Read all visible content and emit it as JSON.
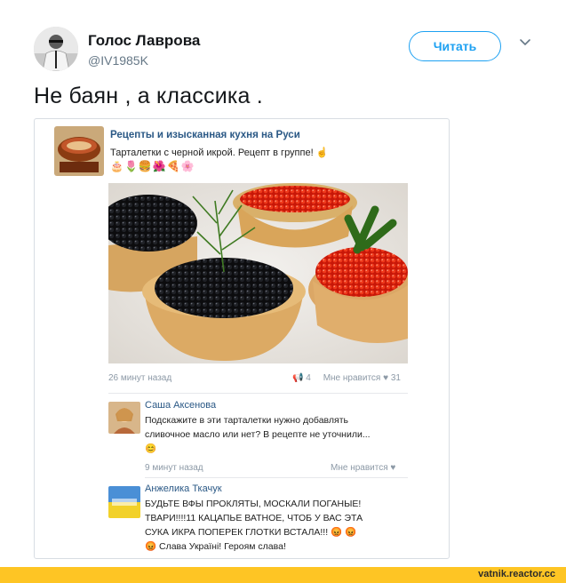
{
  "tweet": {
    "display_name": "Голос Лаврова",
    "handle": "@IV1985K",
    "follow_label": "Читать",
    "text": "Не баян , а классика ."
  },
  "vk_post": {
    "group_name": "Рецепты и изысканная кухня на Руси",
    "post_text": "Тарталетки с черной икрой. Рецепт в группе! ☝",
    "emoji_row": "🎂🌷🍔🌺🍕🌸",
    "time": "26 минут назад",
    "shares": "4",
    "likes_label": "Мне нравится",
    "likes_count": "31"
  },
  "comments": [
    {
      "author": "Саша Аксенова",
      "lines": [
        "Подскажите в эти тарталетки нужно добавлять",
        "сливочное масло или нет? В рецепте не уточнили...",
        "😊"
      ],
      "time": "9 минут назад",
      "like_label": "Мне нравится"
    },
    {
      "author": "Анжелика Ткачук",
      "lines": [
        "БУДЬТЕ ВФЫ ПРОКЛЯТЫ, МОСКАЛИ ПОГАНЫЕ!",
        "ТВАРИ!!!!11 КАЦАПЬЕ ВАТНОЕ, ЧТОБ У ВАС ЭТА",
        "СУКА ИКРА ПОПЕРЕК ГЛОТКИ ВСТАЛА!!! 😡 😡",
        "😡 Слава Україні! Героям слава!"
      ]
    }
  ],
  "watermark": "vatnik.reactor.cc",
  "colors": {
    "twitter_blue": "#1da1f2",
    "vk_link": "#2a5885",
    "banner": "#fec524"
  }
}
